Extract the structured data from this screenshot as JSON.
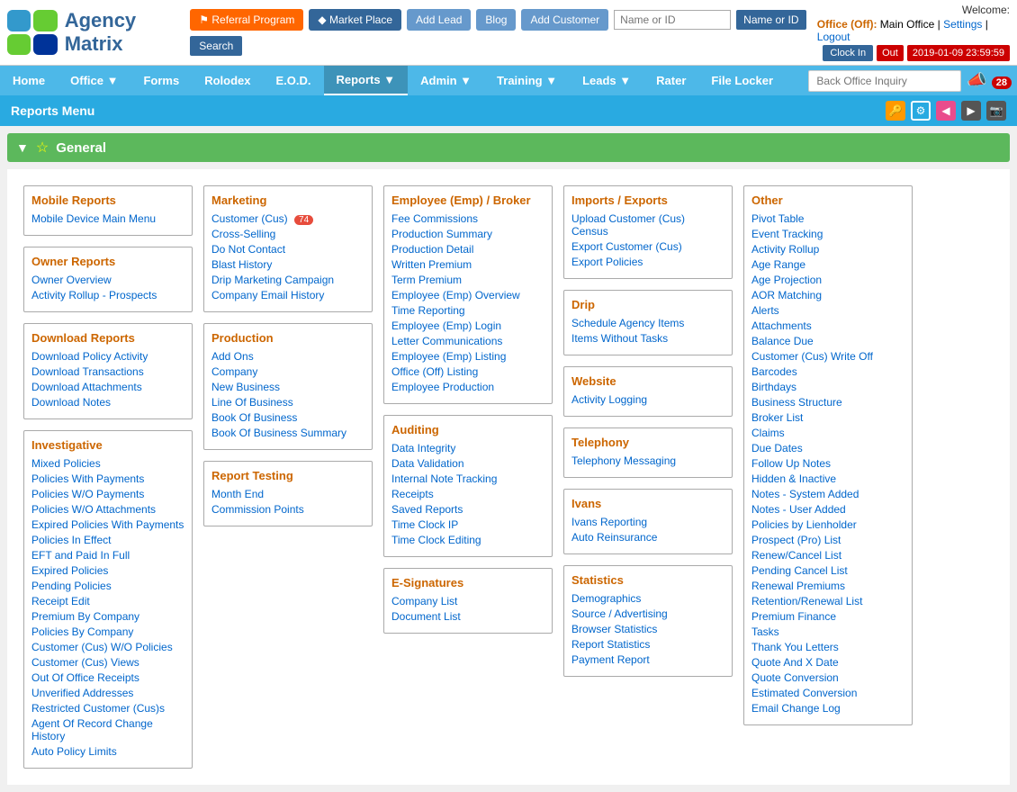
{
  "app": {
    "title": "Agency Matrix"
  },
  "topBar": {
    "welcome": "Welcome:",
    "office_label": "Office (Off):",
    "office_name": "Main Office",
    "settings": "Settings",
    "logout": "Logout",
    "clock_in": "Clock In",
    "out": "Out",
    "clock_time": "2019-01-09 23:59:59",
    "referral_btn": "Referral Program",
    "market_btn": "Market Place",
    "add_lead": "Add Lead",
    "blog": "Blog",
    "add_customer": "Add Customer",
    "search_placeholder": "Name or ID",
    "search_btn": "Search"
  },
  "nav": {
    "items": [
      {
        "label": "Home",
        "has_arrow": false
      },
      {
        "label": "Office",
        "has_arrow": true
      },
      {
        "label": "Forms",
        "has_arrow": false
      },
      {
        "label": "Rolodex",
        "has_arrow": false
      },
      {
        "label": "E.O.D.",
        "has_arrow": false
      },
      {
        "label": "Reports",
        "has_arrow": true,
        "active": true
      },
      {
        "label": "Admin",
        "has_arrow": true
      },
      {
        "label": "Training",
        "has_arrow": true
      },
      {
        "label": "Leads",
        "has_arrow": true
      },
      {
        "label": "Rater",
        "has_arrow": false
      },
      {
        "label": "File Locker",
        "has_arrow": false
      }
    ],
    "back_office_placeholder": "Back Office Inquiry",
    "notification_count": "28"
  },
  "reportsMenu": {
    "title": "Reports Menu"
  },
  "general": {
    "label": "General"
  },
  "columns": {
    "col1": {
      "mobile": {
        "title": "Mobile Reports",
        "links": [
          "Mobile Device Main Menu"
        ]
      },
      "owner": {
        "title": "Owner Reports",
        "links": [
          "Owner Overview",
          "Activity Rollup - Prospects"
        ]
      },
      "download": {
        "title": "Download Reports",
        "links": [
          "Download Policy Activity",
          "Download Transactions",
          "Download Attachments",
          "Download Notes"
        ]
      },
      "investigative": {
        "title": "Investigative",
        "links": [
          "Mixed Policies",
          "Policies With Payments",
          "Policies W/O Payments",
          "Policies W/O Attachments",
          "Expired Policies With Payments",
          "Policies In Effect",
          "EFT and Paid In Full",
          "Expired Policies",
          "Pending Policies",
          "Receipt Edit",
          "Premium By Company",
          "Policies By Company",
          "Customer (Cus) W/O Policies",
          "Customer (Cus) Views",
          "Out Of Office Receipts",
          "Unverified Addresses",
          "Restricted Customer (Cus)s",
          "Agent Of Record Change History",
          "Auto Policy Limits"
        ]
      }
    },
    "col2": {
      "marketing": {
        "title": "Marketing",
        "links": [
          "Customer (Cus)",
          "Cross-Selling",
          "Do Not Contact",
          "Blast History",
          "Drip Marketing Campaign",
          "Company Email History"
        ],
        "badge_index": 0,
        "badge_value": "74"
      },
      "production": {
        "title": "Production",
        "links": [
          "Add Ons",
          "Company",
          "New Business",
          "Line Of Business",
          "Book Of Business",
          "Book Of Business Summary"
        ]
      },
      "report_testing": {
        "title": "Report Testing",
        "links": [
          "Month End",
          "Commission Points"
        ]
      }
    },
    "col3": {
      "employee": {
        "title": "Employee (Emp) / Broker",
        "links": [
          "Fee Commissions",
          "Production Summary",
          "Production Detail",
          "Written Premium",
          "Term Premium",
          "Employee (Emp) Overview",
          "Time Reporting",
          "Employee (Emp) Login",
          "Letter Communications",
          "Employee (Emp) Listing",
          "Office (Off) Listing",
          "Employee Production"
        ]
      },
      "auditing": {
        "title": "Auditing",
        "links": [
          "Data Integrity",
          "Data Validation",
          "Internal Note Tracking",
          "Receipts",
          "Saved Reports",
          "Time Clock IP",
          "Time Clock Editing"
        ]
      },
      "esignatures": {
        "title": "E-Signatures",
        "links": [
          "Company List",
          "Document List"
        ]
      }
    },
    "col4": {
      "imports": {
        "title": "Imports / Exports",
        "links": [
          "Upload Customer (Cus) Census",
          "Export Customer (Cus)",
          "Export Policies"
        ]
      },
      "drip": {
        "title": "Drip",
        "links": [
          "Schedule Agency Items",
          "Items Without Tasks"
        ]
      },
      "website": {
        "title": "Website",
        "links": [
          "Activity Logging"
        ]
      },
      "telephony": {
        "title": "Telephony",
        "links": [
          "Telephony Messaging"
        ]
      },
      "ivans": {
        "title": "Ivans",
        "links": [
          "Ivans Reporting",
          "Auto Reinsurance"
        ]
      },
      "statistics": {
        "title": "Statistics",
        "links": [
          "Demographics",
          "Source / Advertising",
          "Browser Statistics",
          "Report Statistics",
          "Payment Report"
        ]
      }
    },
    "col5": {
      "other": {
        "title": "Other",
        "links": [
          "Pivot Table",
          "Event Tracking",
          "Activity Rollup",
          "Age Range",
          "Age Projection",
          "AOR Matching",
          "Alerts",
          "Attachments",
          "Balance Due",
          "Customer (Cus) Write Off",
          "Barcodes",
          "Birthdays",
          "Business Structure",
          "Broker List",
          "Claims",
          "Due Dates",
          "Follow Up Notes",
          "Hidden & Inactive",
          "Notes - System Added",
          "Notes - User Added",
          "Policies by Lienholder",
          "Prospect (Pro) List",
          "Renew/Cancel List",
          "Pending Cancel List",
          "Renewal Premiums",
          "Retention/Renewal List",
          "Premium Finance",
          "Tasks",
          "Thank You Letters",
          "Quote And X Date",
          "Quote Conversion",
          "Estimated Conversion",
          "Email Change Log"
        ]
      }
    }
  }
}
